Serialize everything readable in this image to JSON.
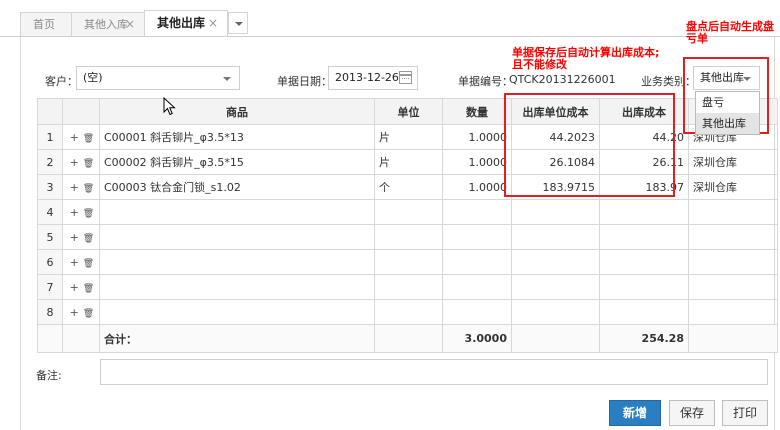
{
  "tabs": [
    {
      "label": "首页"
    },
    {
      "label": "其他入库"
    },
    {
      "label": "其他出库"
    }
  ],
  "close_glyph": "×",
  "form": {
    "customer_label": "客户：",
    "customer_value": "(空)",
    "date_label": "单据日期：",
    "date_value": "2013-12-26",
    "docno_label": "单据编号：",
    "docno_value": "QTCK20131226001",
    "bizcat_label": "业务类别：",
    "bizcat_value": "其他出库"
  },
  "bizcat_options": [
    "盘亏",
    "其他出库"
  ],
  "table": {
    "headers": [
      "商品",
      "单位",
      "数量",
      "出库单位成本",
      "出库成本"
    ],
    "rows": [
      {
        "no": "1",
        "product": "C00001 斜舌铆片_φ3.5*13",
        "unit": "片",
        "qty": "1.0000",
        "unit_cost": "44.2023",
        "cost": "44.20",
        "warehouse": "深圳仓库"
      },
      {
        "no": "2",
        "product": "C00002 斜舌铆片_φ3.5*15",
        "unit": "片",
        "qty": "1.0000",
        "unit_cost": "26.1084",
        "cost": "26.11",
        "warehouse": "深圳仓库"
      },
      {
        "no": "3",
        "product": "C00003 钛合金门锁_s1.02",
        "unit": "个",
        "qty": "1.0000",
        "unit_cost": "183.9715",
        "cost": "183.97",
        "warehouse": "深圳仓库"
      },
      {
        "no": "4",
        "product": "",
        "unit": "",
        "qty": "",
        "unit_cost": "",
        "cost": "",
        "warehouse": ""
      },
      {
        "no": "5",
        "product": "",
        "unit": "",
        "qty": "",
        "unit_cost": "",
        "cost": "",
        "warehouse": ""
      },
      {
        "no": "6",
        "product": "",
        "unit": "",
        "qty": "",
        "unit_cost": "",
        "cost": "",
        "warehouse": ""
      },
      {
        "no": "7",
        "product": "",
        "unit": "",
        "qty": "",
        "unit_cost": "",
        "cost": "",
        "warehouse": ""
      },
      {
        "no": "8",
        "product": "",
        "unit": "",
        "qty": "",
        "unit_cost": "",
        "cost": "",
        "warehouse": ""
      }
    ],
    "total_label": "合计：",
    "total_qty": "3.0000",
    "total_cost": "254.28"
  },
  "op_glyphs": {
    "add": "+",
    "delete": "🗑"
  },
  "remark_label": "备注:",
  "buttons": {
    "new": "新增",
    "save": "保存",
    "print": "打印"
  },
  "annotations": {
    "cost_note_line1": "单据保存后自动计算出库成本;",
    "cost_note_line2": "且不能修改",
    "inventory_note_line1": "盘点后自动生成盘",
    "inventory_note_line2": "亏单"
  },
  "colors": {
    "accent": "#2a7fc2",
    "annotation": "#ff0000"
  }
}
